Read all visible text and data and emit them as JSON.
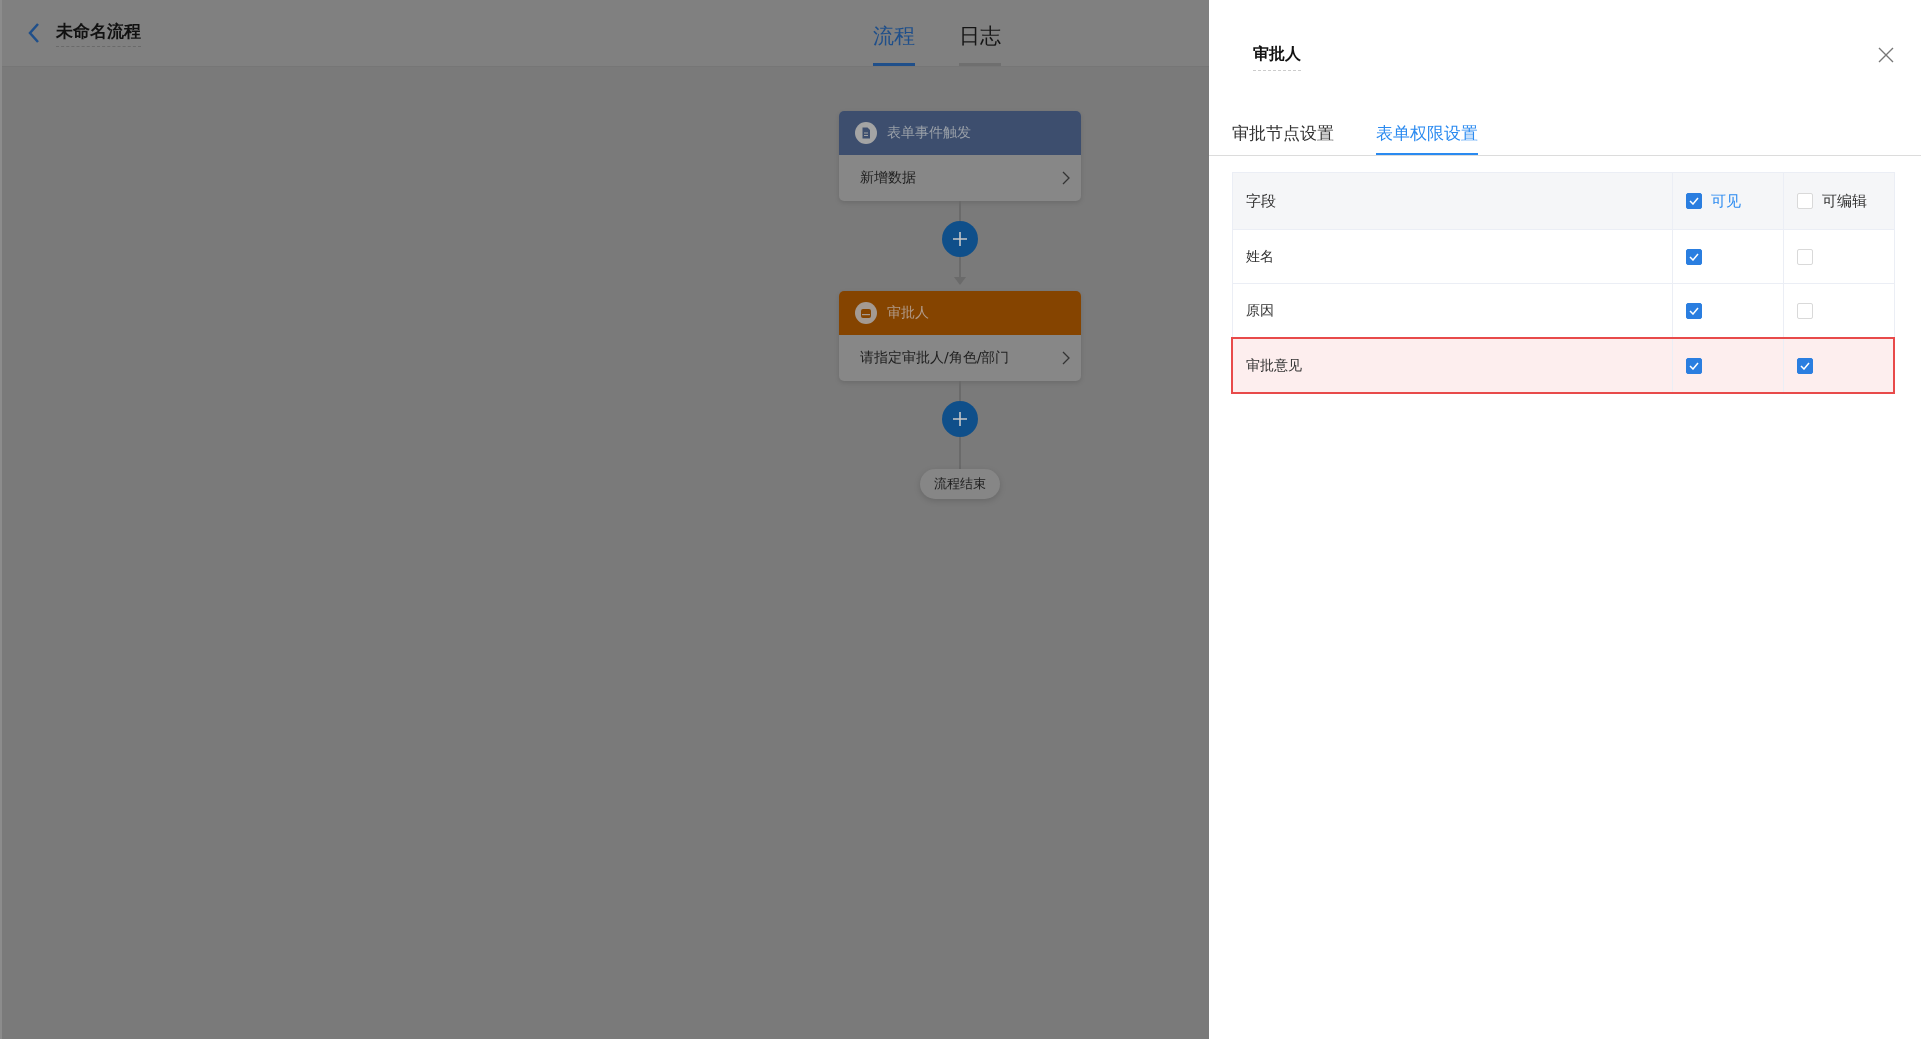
{
  "header": {
    "title": "未命名流程",
    "tabs": [
      {
        "label": "流程",
        "selected": true
      },
      {
        "label": "日志",
        "selected": false
      }
    ]
  },
  "flow": {
    "nodes": [
      {
        "kind": "trigger",
        "title": "表单事件触发",
        "content": "新增数据"
      },
      {
        "kind": "approver",
        "title": "审批人",
        "content": "请指定审批人/角色/部门"
      }
    ],
    "end_label": "流程结束"
  },
  "panel": {
    "title": "审批人",
    "tabs": [
      {
        "label": "审批节点设置",
        "selected": false
      },
      {
        "label": "表单权限设置",
        "selected": true
      }
    ],
    "table": {
      "columns": [
        {
          "label": "字段"
        },
        {
          "label": "可见",
          "checked": true
        },
        {
          "label": "可编辑",
          "checked": false
        }
      ],
      "rows": [
        {
          "field": "姓名",
          "visible": true,
          "editable": false,
          "highlighted": false
        },
        {
          "field": "原因",
          "visible": true,
          "editable": false,
          "highlighted": false
        },
        {
          "field": "审批意见",
          "visible": true,
          "editable": true,
          "highlighted": true
        }
      ]
    }
  }
}
